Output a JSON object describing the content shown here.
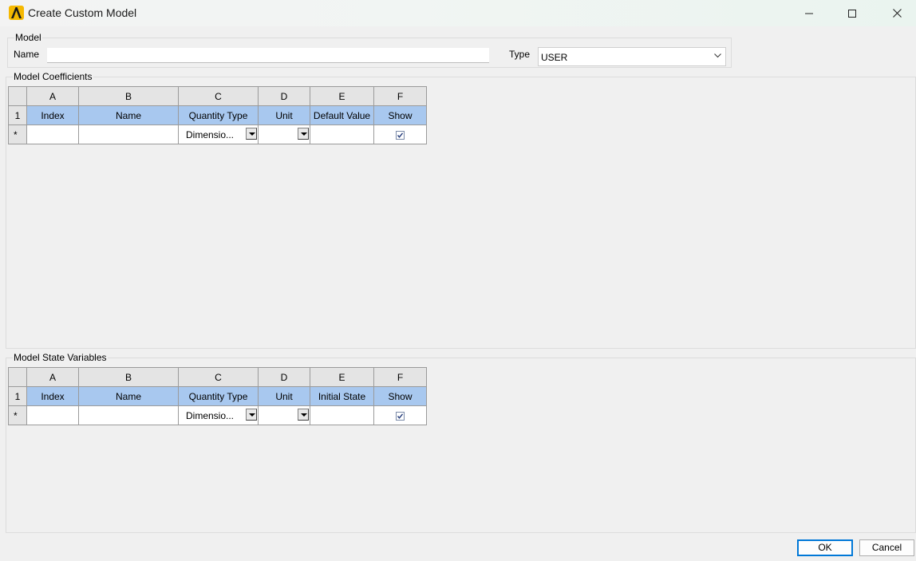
{
  "window": {
    "title": "Create Custom Model"
  },
  "model_group": {
    "legend": "Model",
    "name_label": "Name",
    "name_value": "",
    "type_label": "Type",
    "type_value": "USER"
  },
  "coefficients": {
    "legend": "Model Coefficients",
    "column_letters": [
      "A",
      "B",
      "C",
      "D",
      "E",
      "F"
    ],
    "header_row_number": "1",
    "headers": [
      "Index",
      "Name",
      "Quantity Type",
      "Unit",
      "Default Value",
      "Show"
    ],
    "new_row_marker": "*",
    "new_row": {
      "index": "",
      "name": "",
      "quantity_type": "Dimensio...",
      "unit": "",
      "default_value": "",
      "show_checked": true
    }
  },
  "state_variables": {
    "legend": "Model State Variables",
    "column_letters": [
      "A",
      "B",
      "C",
      "D",
      "E",
      "F"
    ],
    "header_row_number": "1",
    "headers": [
      "Index",
      "Name",
      "Quantity Type",
      "Unit",
      "Initial State",
      "Show"
    ],
    "new_row_marker": "*",
    "new_row": {
      "index": "",
      "name": "",
      "quantity_type": "Dimensio...",
      "unit": "",
      "initial_state": "",
      "show_checked": true
    }
  },
  "buttons": {
    "ok": "OK",
    "cancel": "Cancel"
  },
  "icons": {
    "app": "ansys-logo-icon",
    "minimize": "minimize-icon",
    "maximize": "maximize-icon",
    "close": "close-icon"
  },
  "colors": {
    "header_fill": "#a8c8ef",
    "accent": "#0078d7",
    "logo": "#f5b800"
  }
}
